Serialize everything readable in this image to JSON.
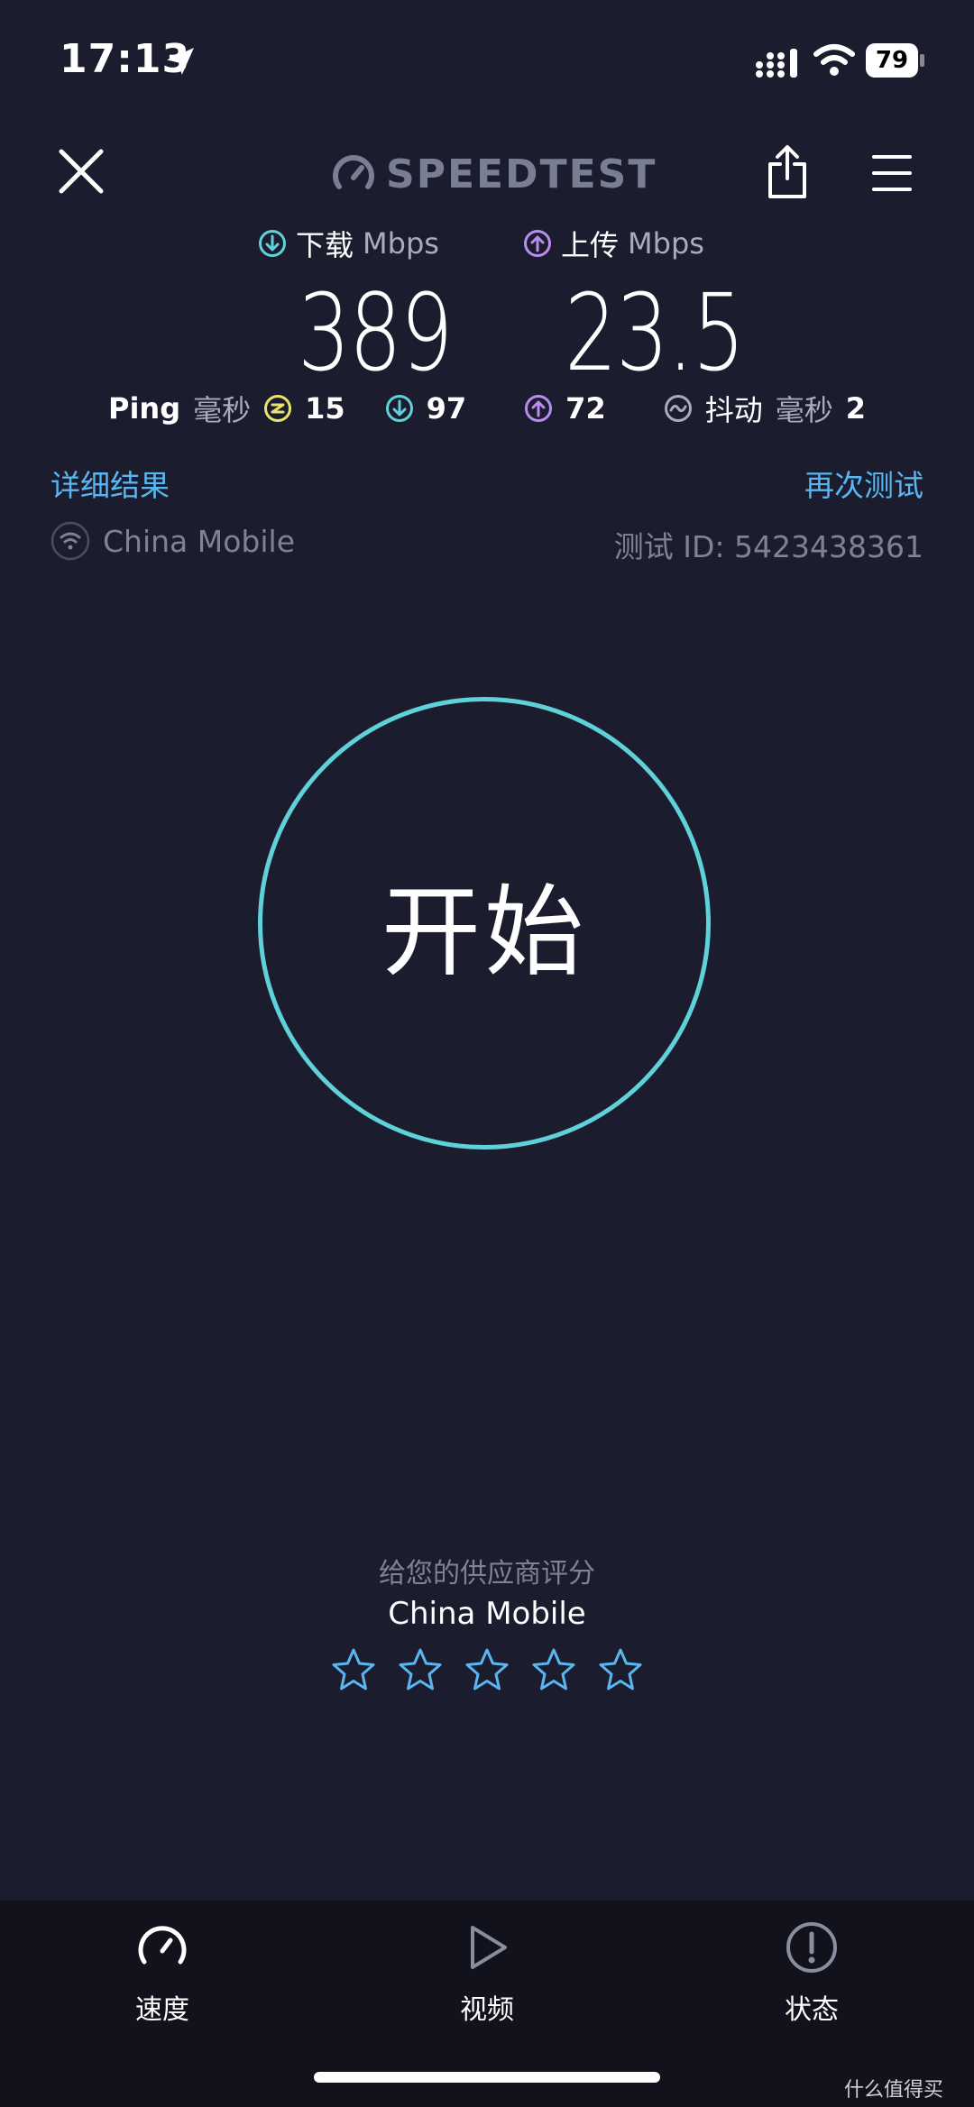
{
  "status_bar": {
    "time": "17:13",
    "battery": "79"
  },
  "header": {
    "logo_text": "SPEEDTEST"
  },
  "download": {
    "label": "下载",
    "unit": "Mbps",
    "value": "389"
  },
  "upload": {
    "label": "上传",
    "unit": "Mbps",
    "value": "23.5"
  },
  "ping": {
    "label": "Ping",
    "unit": "毫秒",
    "idle": "15",
    "download": "97",
    "upload": "72",
    "jitter_label": "抖动",
    "jitter_unit": "毫秒",
    "jitter": "2"
  },
  "links": {
    "details": "详细结果",
    "retest": "再次测试"
  },
  "connection": {
    "isp": "China Mobile",
    "test_id": "测试 ID: 5423438361"
  },
  "go_button": {
    "label": "开始"
  },
  "rating": {
    "prompt": "给您的供应商评分",
    "isp": "China Mobile",
    "stars": 5
  },
  "tabs": [
    {
      "label": "速度",
      "icon": "speedometer-icon",
      "active": true
    },
    {
      "label": "视频",
      "icon": "play-icon"
    },
    {
      "label": "状态",
      "icon": "alert-icon"
    }
  ],
  "watermark": "什么值得买",
  "colors": {
    "background": "#1b1d2e",
    "accent_teal": "#5fd1d9",
    "link_blue": "#59b6f0",
    "upload_purple": "#b98cf0",
    "ping_yellow": "#e8e36a"
  }
}
